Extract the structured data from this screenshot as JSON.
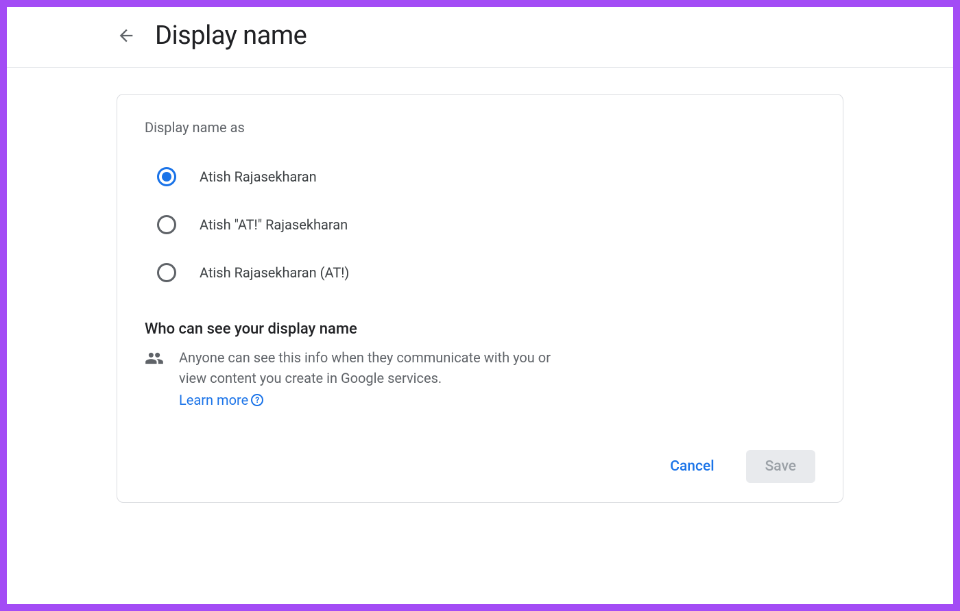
{
  "header": {
    "title": "Display name"
  },
  "section": {
    "label": "Display name as"
  },
  "radioOptions": [
    {
      "label": "Atish Rajasekharan",
      "selected": true
    },
    {
      "label": "Atish \"AT!\" Rajasekharan",
      "selected": false
    },
    {
      "label": "Atish Rajasekharan (AT!)",
      "selected": false
    }
  ],
  "visibility": {
    "title": "Who can see your display name",
    "description": "Anyone can see this info when they communicate with you or view content you create in Google services.",
    "learnMore": "Learn more"
  },
  "buttons": {
    "cancel": "Cancel",
    "save": "Save"
  }
}
